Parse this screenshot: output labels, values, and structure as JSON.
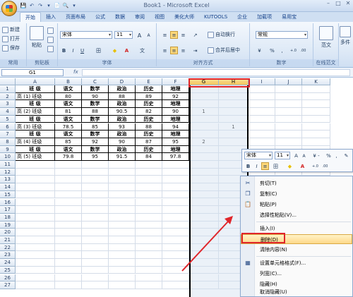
{
  "window": {
    "title": "Book1 - Microsoft Excel",
    "min": "–",
    "max": "□",
    "close": "✕"
  },
  "qat": [
    "💾",
    "↶",
    "↷",
    "▾",
    "📄",
    "🔍",
    "▾"
  ],
  "tabs": [
    "开始",
    "插入",
    "页面布局",
    "公式",
    "数据",
    "审阅",
    "视图",
    "美化大师",
    "KUTOOLS",
    "企业",
    "加载项",
    "易用宝"
  ],
  "ribbon": {
    "clipboard": {
      "label": "剪贴板",
      "new": "新建",
      "open": "打开",
      "save": "保存",
      "paste": "粘贴",
      "common": "常用"
    },
    "font": {
      "label": "字体",
      "family": "宋体",
      "size": "11",
      "grow": "A",
      "shrink": "A",
      "bold": "B",
      "italic": "I",
      "underline": "U",
      "border": "田",
      "fill": "◆",
      "color": "A",
      "phon": "文"
    },
    "align": {
      "label": "对齐方式",
      "wrap": "自动换行",
      "merge": "合并后居中"
    },
    "number": {
      "label": "数字",
      "format": "常规",
      "pct": "%",
      "comma": ","
    },
    "style": {
      "label": "在线范文",
      "fanwen": "范文"
    },
    "right": {
      "label": "多件"
    }
  },
  "formula_bar": {
    "name_box": "G1",
    "fx": "fx",
    "value": ""
  },
  "columns": [
    "A",
    "B",
    "C",
    "D",
    "E",
    "F",
    "G",
    "H",
    "I",
    "J",
    "K"
  ],
  "rows": [
    "1",
    "2",
    "3",
    "4",
    "5",
    "6",
    "7",
    "8",
    "9",
    "10",
    "11",
    "12",
    "13",
    "14",
    "15",
    "16",
    "17",
    "18",
    "19",
    "20",
    "21",
    "22",
    "23",
    "24",
    "25",
    "26",
    "27"
  ],
  "table": [
    [
      "班  级",
      "语文",
      "数学",
      "政治",
      "历史",
      "地理"
    ],
    [
      "高 (1) 班级",
      "80",
      "90",
      "88",
      "89",
      "92"
    ],
    [
      "班  级",
      "语文",
      "数学",
      "政治",
      "历史",
      "地理"
    ],
    [
      "高 (2) 班级",
      "81",
      "88",
      "90.5",
      "82",
      "90"
    ],
    [
      "班  级",
      "语文",
      "数学",
      "政治",
      "历史",
      "地理"
    ],
    [
      "高 (3) 班级",
      "78.5",
      "85",
      "93",
      "88",
      "94"
    ],
    [
      "班  级",
      "语文",
      "数学",
      "政治",
      "历史",
      "地理"
    ],
    [
      "高 (4) 班级",
      "85",
      "92",
      "90",
      "87",
      "95"
    ],
    [
      "班  级",
      "语文",
      "数学",
      "政治",
      "历史",
      "地理"
    ],
    [
      "高 (5) 班级",
      "79.8",
      "95",
      "91.5",
      "84",
      "97.8"
    ]
  ],
  "gcol": {
    "r4": "1",
    "r8": "2"
  },
  "hcol": {
    "r6": "1"
  },
  "mini_toolbar": {
    "font": "宋体",
    "size": "11",
    "grow": "A",
    "shrink": "A",
    "fmt": "¥ -",
    "pct": "%",
    "comma": ",",
    "bold": "B",
    "italic": "I",
    "align": "≡",
    "fill": "◆",
    "color": "A",
    "inc": "+.0",
    "dec": ".00"
  },
  "context_menu": [
    "剪切(T)",
    "复制(C)",
    "粘贴(P)",
    "选择性粘贴(V)...",
    "插入(I)",
    "删除(D)",
    "清除内容(N)",
    "设置单元格格式(F)...",
    "列宽(C)...",
    "隐藏(H)",
    "取消隐藏(U)"
  ],
  "colors": {
    "highlight": "#e0262b",
    "menu_hover": "#ffd98a"
  }
}
